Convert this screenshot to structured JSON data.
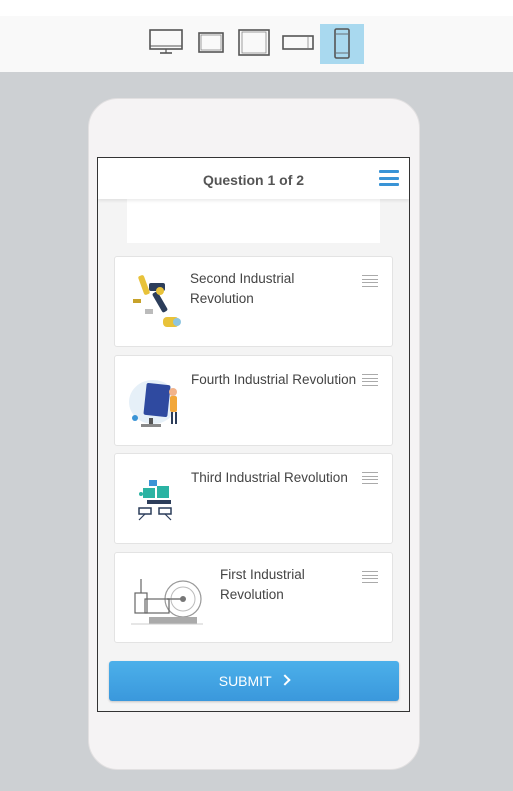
{
  "toolbar": {
    "devices": [
      {
        "icon": "desktop-icon",
        "active": false
      },
      {
        "icon": "tablet-icon",
        "active": false
      },
      {
        "icon": "tablet-portrait-icon",
        "active": false
      },
      {
        "icon": "phone-landscape-icon",
        "active": false
      },
      {
        "icon": "phone-portrait-icon",
        "active": true
      }
    ],
    "active_color": "#a9d9ef"
  },
  "quiz": {
    "title": "Question 1 of 2",
    "items": [
      {
        "label": "Second Industrial Revolution",
        "illustration": "robot-arm-illustration"
      },
      {
        "label": "Fourth Industrial Revolution",
        "illustration": "person-with-screen-illustration"
      },
      {
        "label": "Third Industrial Revolution",
        "illustration": "computer-network-illustration"
      },
      {
        "label": "First Industrial Revolution",
        "illustration": "steam-engine-illustration"
      }
    ],
    "submit_label": "SUBMIT",
    "submit_icon": "chevron-right-icon"
  },
  "colors": {
    "accent": "#3a98dc",
    "canvas": "#cdd0d3"
  }
}
